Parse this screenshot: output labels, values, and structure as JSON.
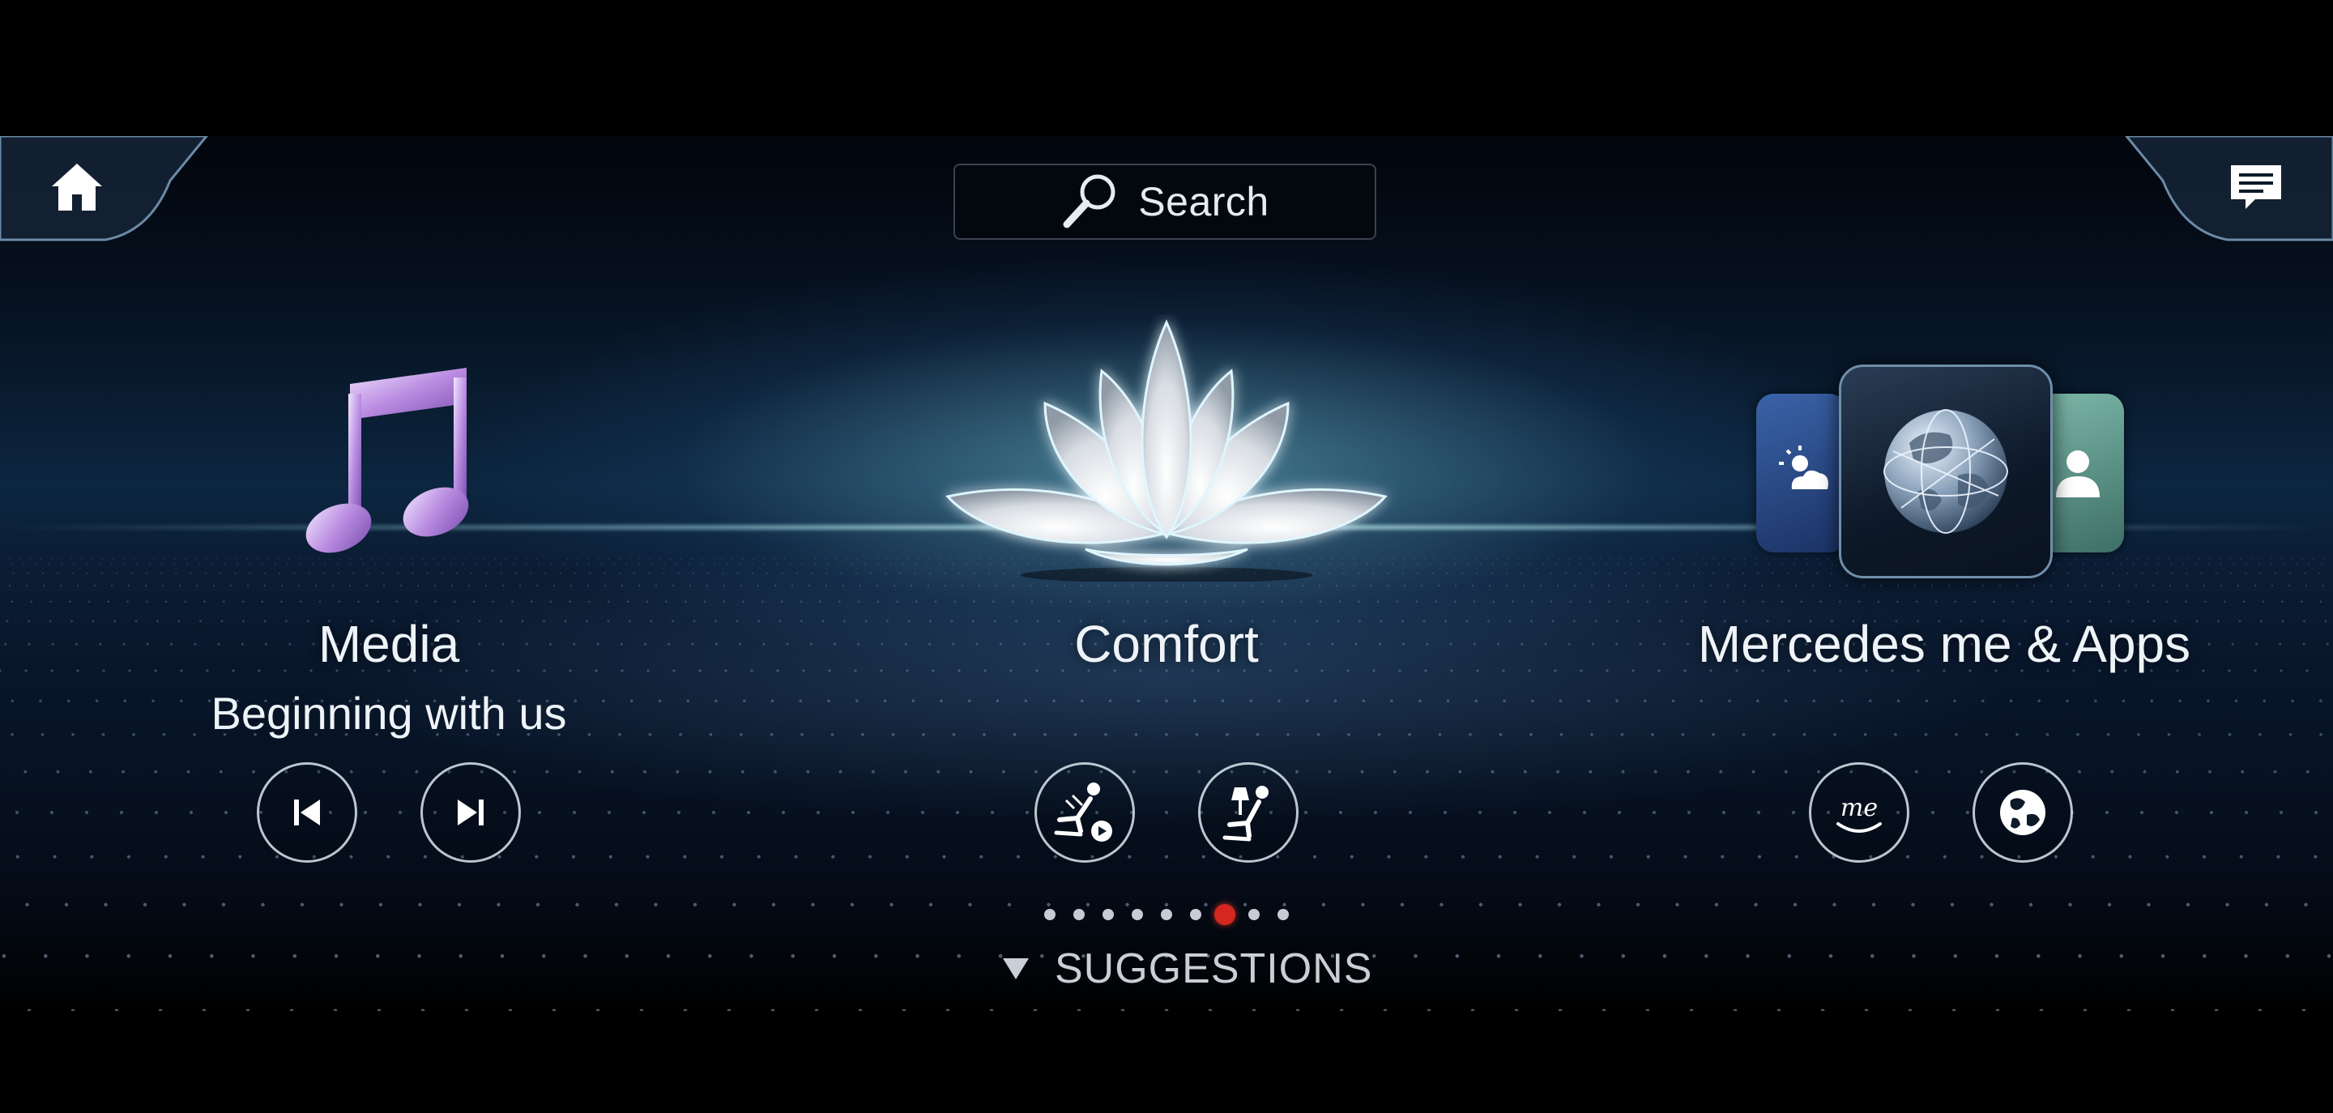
{
  "header": {
    "search_label": "Search"
  },
  "tiles": [
    {
      "title": "Media",
      "subtitle": "Beginning with us"
    },
    {
      "title": "Comfort"
    },
    {
      "title": "Mercedes me & Apps"
    }
  ],
  "media_controls": {
    "previous_icon": "skip-previous-icon",
    "next_icon": "skip-next-icon"
  },
  "comfort_controls": {
    "massage_icon": "seat-massage-icon",
    "seat_light_icon": "seat-lamp-icon"
  },
  "apps_controls": {
    "me_icon": "mercedes-me-icon",
    "globe_icon": "globe-icon"
  },
  "pagination": {
    "total": 9,
    "active_index": 6
  },
  "footer": {
    "suggestions_label": "SUGGESTIONS"
  },
  "colors": {
    "accent_active_dot": "#d3271f",
    "media_icon": "#c9a6e6",
    "weather_tile": "#25457a",
    "contact_tile": "#5f9a8c"
  }
}
